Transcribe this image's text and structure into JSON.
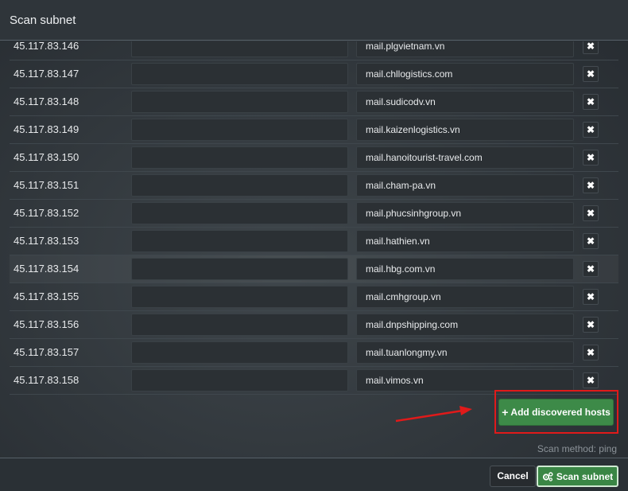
{
  "dialog": {
    "title": "Scan subnet"
  },
  "hosts": [
    {
      "ip": "45.117.83.146",
      "hostname": "mail.plgvietnam.vn"
    },
    {
      "ip": "45.117.83.147",
      "hostname": "mail.chllogistics.com"
    },
    {
      "ip": "45.117.83.148",
      "hostname": "mail.sudicodv.vn"
    },
    {
      "ip": "45.117.83.149",
      "hostname": "mail.kaizenlogistics.vn"
    },
    {
      "ip": "45.117.83.150",
      "hostname": "mail.hanoitourist-travel.com"
    },
    {
      "ip": "45.117.83.151",
      "hostname": "mail.cham-pa.vn"
    },
    {
      "ip": "45.117.83.152",
      "hostname": "mail.phucsinhgroup.vn"
    },
    {
      "ip": "45.117.83.153",
      "hostname": "mail.hathien.vn"
    },
    {
      "ip": "45.117.83.154",
      "hostname": "mail.hbg.com.vn"
    },
    {
      "ip": "45.117.83.155",
      "hostname": "mail.cmhgroup.vn"
    },
    {
      "ip": "45.117.83.156",
      "hostname": "mail.dnpshipping.com"
    },
    {
      "ip": "45.117.83.157",
      "hostname": "mail.tuanlongmy.vn"
    },
    {
      "ip": "45.117.83.158",
      "hostname": "mail.vimos.vn"
    }
  ],
  "delete_icon": "close-icon",
  "add_button": {
    "label": "Add discovered hosts",
    "icon": "plus-icon"
  },
  "scan_method": "Scan method: ping",
  "footer": {
    "cancel_label": "Cancel",
    "scan_label": "Scan subnet",
    "scan_icon": "gears-icon"
  },
  "colors": {
    "accent_green": "#3d8a48",
    "highlight_red": "#e01a1a"
  }
}
